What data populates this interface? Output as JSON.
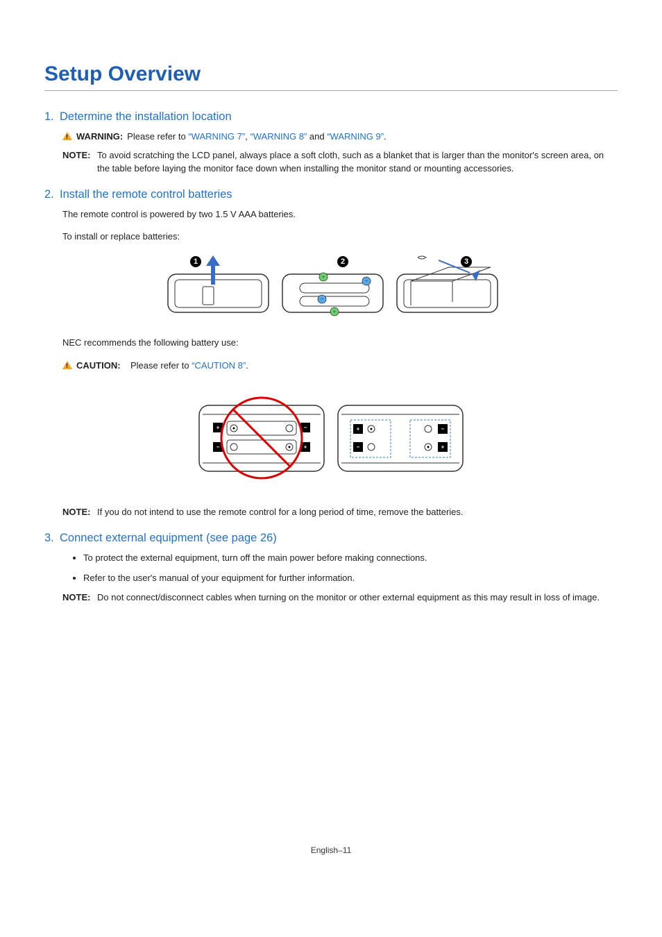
{
  "title": "Setup Overview",
  "sections": {
    "s1": {
      "num": "1.",
      "heading": "Determine the installation location",
      "warning_label": "WARNING:",
      "warning_pre": "Please refer to ",
      "warning_link1": "“WARNING 7”",
      "warning_sep1": ", ",
      "warning_link2": "“WARNING 8”",
      "warning_sep2": " and ",
      "warning_link3": "“WARNING 9”",
      "warning_post": ".",
      "note_label": "NOTE:",
      "note_text": "To avoid scratching the LCD panel, always place a soft cloth, such as a blanket that is larger than the monitor's screen area, on the table before laying the monitor face down when installing the monitor stand or mounting accessories."
    },
    "s2": {
      "num": "2.",
      "heading": "Install the remote control batteries",
      "p1": "The remote control is powered by two 1.5 V AAA batteries.",
      "p2": "To install or replace batteries:",
      "rec": "NEC recommends the following battery use:",
      "caution_label": "CAUTION:",
      "caution_pre": "Please refer to ",
      "caution_link": "“CAUTION 8”",
      "caution_post": ".",
      "note_label": "NOTE:",
      "note_text": "If you do not intend to use the remote control for a long period of time, remove the batteries."
    },
    "s3": {
      "num": "3.",
      "heading": "Connect external equipment (see page 26)",
      "b1": "To protect the external equipment, turn off the main power before making connections.",
      "b2": "Refer to the user's manual of your equipment for further information.",
      "note_label": "NOTE:",
      "note_text": "Do not connect/disconnect cables when turning on the monitor or other external equipment as this may result in loss of image."
    }
  },
  "footer": "English–11"
}
